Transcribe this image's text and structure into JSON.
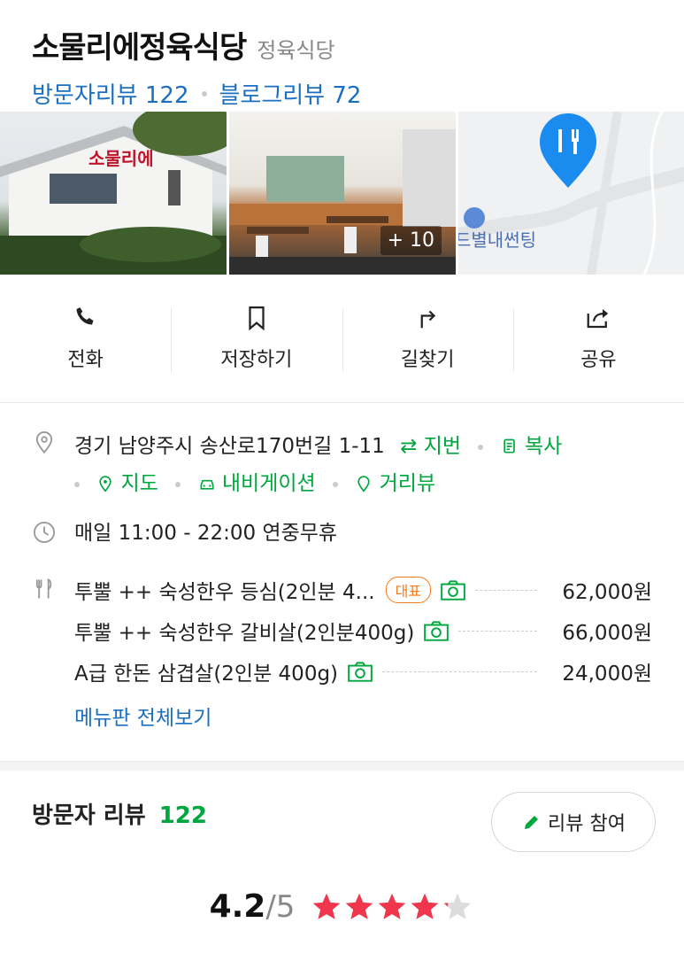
{
  "place": {
    "name": "소물리에정육식당",
    "category": "정육식당",
    "visitor_reviews": "방문자리뷰 122",
    "blog_reviews": "블로그리뷰 72"
  },
  "photos": {
    "more": "+ 10",
    "map_label": "드별내썬팅",
    "sign_text": "소물리에"
  },
  "actions": [
    {
      "label": "전화",
      "icon": "phone-icon"
    },
    {
      "label": "저장하기",
      "icon": "bookmark-icon"
    },
    {
      "label": "길찾기",
      "icon": "directions-icon"
    },
    {
      "label": "공유",
      "icon": "share-icon"
    }
  ],
  "address": {
    "text": "경기 남양주시 송산로170번길 1-11",
    "jibun": "⇄ 지번",
    "copy": "복사",
    "map": "지도",
    "navigation": "내비게이션",
    "streetview": "거리뷰"
  },
  "hours": "매일 11:00 - 22:00 연중무휴",
  "menu": {
    "items": [
      {
        "name": "투뿔 ++ 숙성한우 등심(2인분 4...",
        "badge": "대표",
        "price": "62,000원"
      },
      {
        "name": "투뿔 ++ 숙성한우 갈비살(2인분400g)",
        "price": "66,000원"
      },
      {
        "name": "A급 한돈 삼겹살(2인분 400g)",
        "price": "24,000원"
      }
    ],
    "view_all": "메뉴판 전체보기"
  },
  "visitor": {
    "title": "방문자 리뷰",
    "count": "122",
    "write_button": "리뷰 참여",
    "score": "4.2",
    "out_of": "/5"
  },
  "rating_fraction": 0.84,
  "colors": {
    "link": "#1a6fc1",
    "green": "#00a63e",
    "star": "#f0364c",
    "badge": "#f37a1a",
    "pin": "#1a8cf0"
  }
}
